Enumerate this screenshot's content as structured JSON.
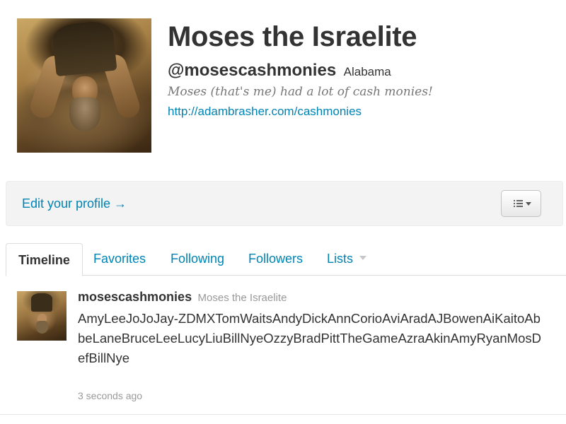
{
  "profile": {
    "name": "Moses the Israelite",
    "handle": "@mosescashmonies",
    "location": "Alabama",
    "bio": "Moses (that's me) had a lot of cash monies!",
    "url": "http://adambrasher.com/cashmonies"
  },
  "actions": {
    "edit_profile_label": "Edit your profile →",
    "settings_menu_icon": "list-dropdown-icon"
  },
  "tabs": [
    {
      "label": "Timeline",
      "active": true
    },
    {
      "label": "Favorites",
      "active": false
    },
    {
      "label": "Following",
      "active": false
    },
    {
      "label": "Followers",
      "active": false
    },
    {
      "label": "Lists",
      "active": false
    }
  ],
  "timeline": {
    "tweets": [
      {
        "screen_name": "mosescashmonies",
        "full_name": "Moses the Israelite",
        "text": "AmyLeeJoJoJay-ZDMXTomWaitsAndyDickAnnCorioAviAradAJBowenAiKaitoAbbeLaneBruceLeeLucyLiuBillNyeOzzyBradPittTheGameAzraAkinAmyRyanMosDefBillNye",
        "time": "3 seconds ago"
      }
    ]
  },
  "colors": {
    "link": "#0084b4",
    "text": "#333333",
    "muted": "#999999",
    "bar_background": "#f3f3f3"
  }
}
